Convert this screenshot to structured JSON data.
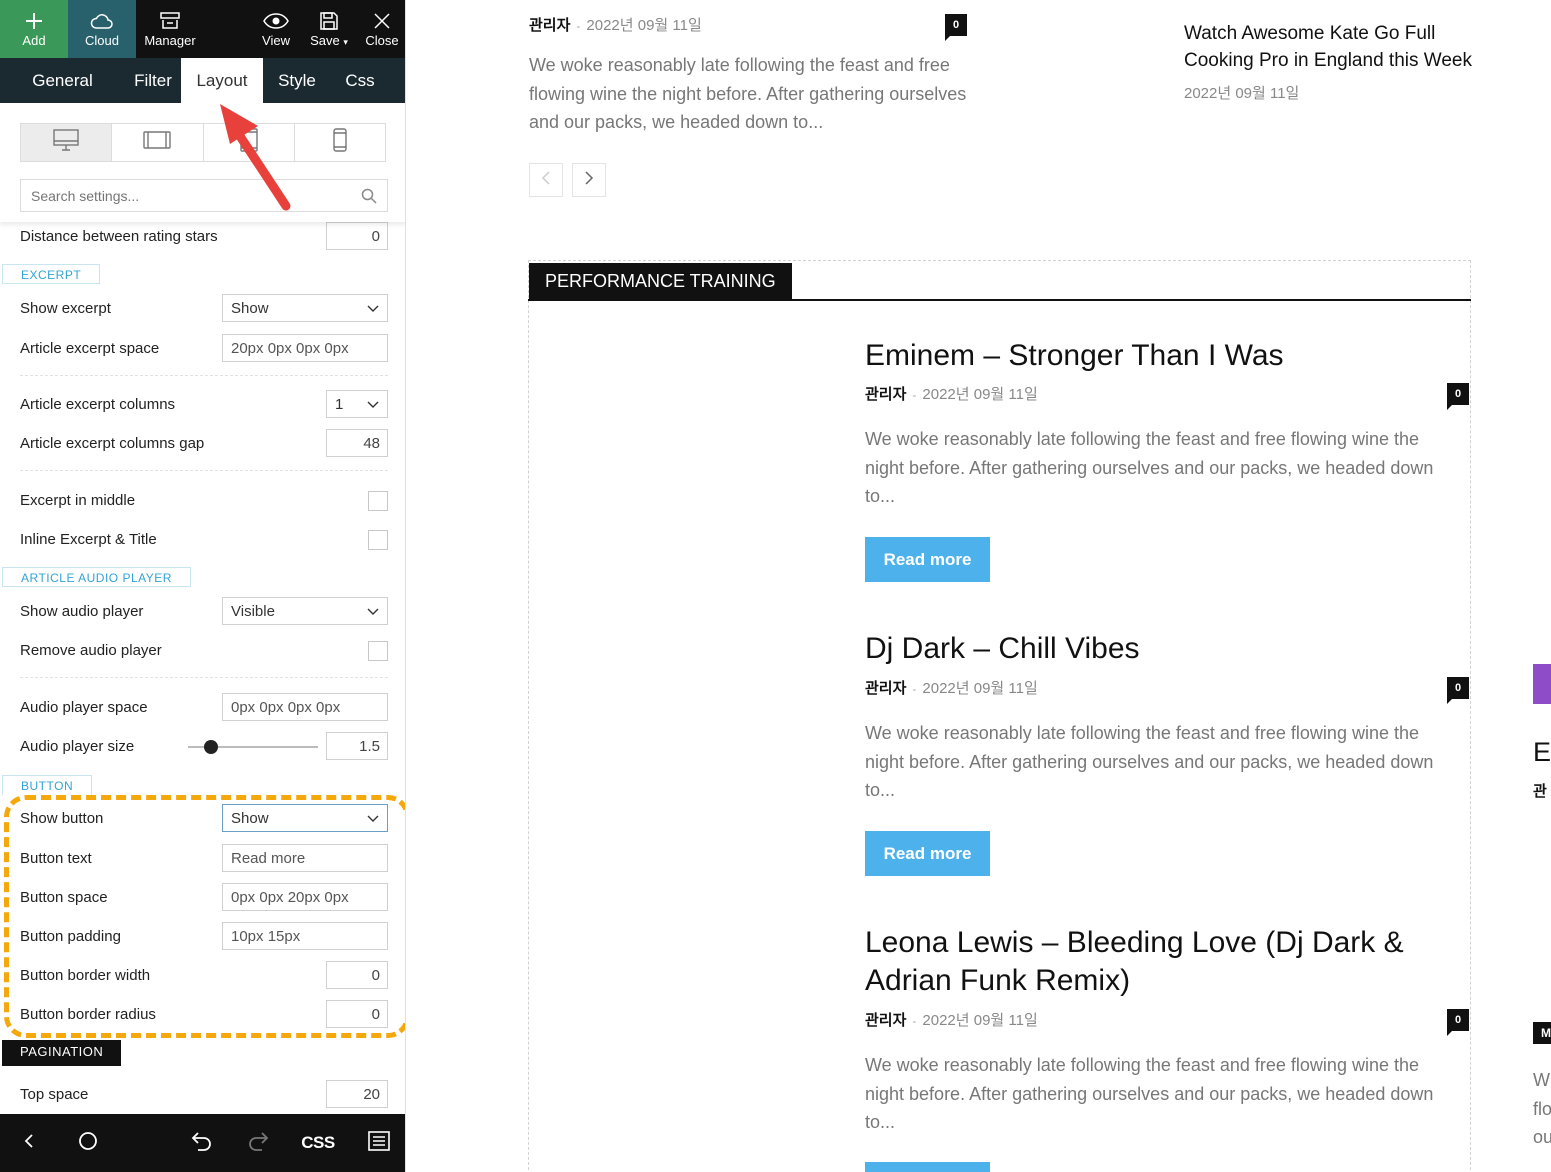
{
  "toolbar": {
    "add": "Add",
    "cloud": "Cloud",
    "manager": "Manager",
    "view": "View",
    "save": "Save",
    "close": "Close"
  },
  "tabs": [
    "General",
    "Filter",
    "Layout",
    "Style",
    "Css"
  ],
  "active_tab": "Layout",
  "search": {
    "placeholder": "Search settings..."
  },
  "settings": {
    "cut_row": {
      "label": "Distance between rating stars",
      "value": "0"
    },
    "excerpt_section": "EXCERPT",
    "show_excerpt": {
      "label": "Show excerpt",
      "value": "Show"
    },
    "excerpt_space": {
      "label": "Article excerpt space",
      "value": "20px 0px 0px 0px"
    },
    "excerpt_columns": {
      "label": "Article excerpt columns",
      "value": "1"
    },
    "excerpt_columns_gap": {
      "label": "Article excerpt columns gap",
      "value": "48"
    },
    "excerpt_middle": {
      "label": "Excerpt in middle"
    },
    "inline_excerpt": {
      "label": "Inline Excerpt & Title"
    },
    "audio_section": "ARTICLE AUDIO PLAYER",
    "show_audio": {
      "label": "Show audio player",
      "value": "Visible"
    },
    "remove_audio": {
      "label": "Remove audio player"
    },
    "audio_space": {
      "label": "Audio player space",
      "value": "0px 0px 0px 0px"
    },
    "audio_size": {
      "label": "Audio player size",
      "value": "1.5"
    },
    "button_section": "BUTTON",
    "show_button": {
      "label": "Show button",
      "value": "Show"
    },
    "button_text": {
      "label": "Button text",
      "value": "Read more"
    },
    "button_space": {
      "label": "Button space",
      "value": "0px 0px 20px 0px"
    },
    "button_padding": {
      "label": "Button padding",
      "value": "10px 15px"
    },
    "button_border_width": {
      "label": "Button border width",
      "value": "0"
    },
    "button_border_radius": {
      "label": "Button border radius",
      "value": "0"
    },
    "pagination_section": "PAGINATION",
    "top_space": {
      "label": "Top space",
      "value": "20"
    }
  },
  "bottombar": {
    "css_label": "CSS"
  },
  "top_post": {
    "author": "관리자",
    "sep": "-",
    "date": "2022년 09월 11일",
    "count": "0",
    "excerpt": "We woke reasonably late following the feast and free flowing wine the night before. After gathering ourselves and our packs, we headed down to..."
  },
  "side_post": {
    "title": "Watch Awesome Kate Go Full Cooking Pro in England this Week",
    "date": "2022년 09월 11일"
  },
  "block": {
    "title": "PERFORMANCE TRAINING",
    "posts": [
      {
        "title": "Eminem – Stronger Than I Was",
        "author": "관리자",
        "sep": "-",
        "date": "2022년 09월 11일",
        "count": "0",
        "excerpt": "We woke reasonably late following the feast and free flowing wine the night before. After gathering ourselves and our packs, we headed down to...",
        "button": "Read more"
      },
      {
        "title": "Dj Dark – Chill Vibes",
        "author": "관리자",
        "sep": "-",
        "date": "2022년 09월 11일",
        "count": "0",
        "excerpt": "We woke reasonably late following the feast and free flowing wine the night before. After gathering ourselves and our packs, we headed down to...",
        "button": "Read more"
      },
      {
        "title": "Leona Lewis – Bleeding Love (Dj Dark & Adrian Funk Remix)",
        "author": "관리자",
        "sep": "-",
        "date": "2022년 09월 11일",
        "count": "0",
        "excerpt": "We woke reasonably late following the feast and free flowing wine the night before. After gathering ourselves and our packs, we headed down to..."
      }
    ]
  },
  "right_edge": {
    "letter": "E",
    "author_partial": "관",
    "badge_partial": "M",
    "excerpt_partial": [
      "W",
      "flo",
      "ou"
    ]
  },
  "colors": {
    "accent_blue": "#4db2ec",
    "add_green": "#3a9958",
    "cloud_teal": "#28616b",
    "highlight_orange": "#f4a80c",
    "arrow_red": "#e8413c",
    "purple_edge": "#8e4cc9"
  }
}
